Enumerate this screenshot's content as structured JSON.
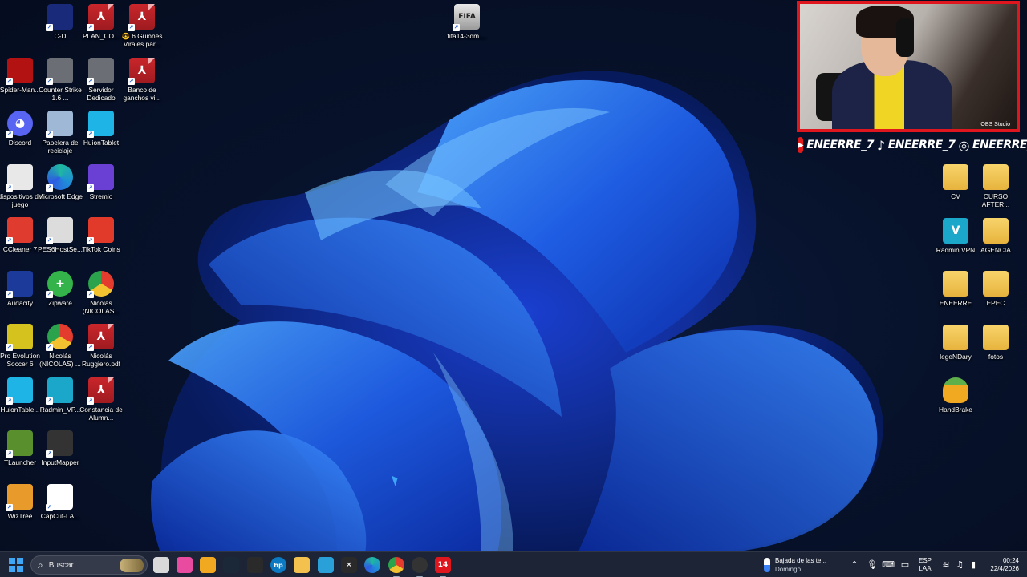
{
  "desktop": {
    "icons_left": [
      {
        "id": "cd",
        "label": "C-D",
        "icon": "ea-fc-icon",
        "color": "#1a2a7a"
      },
      {
        "id": "plan",
        "label": "PLAN_CO...",
        "icon": "pdf-icon",
        "color": "#c9262b"
      },
      {
        "id": "guiones",
        "label": "😎 6 Guiones Virales par...",
        "icon": "pdf-icon",
        "color": "#c9262b"
      },
      {
        "id": "spider",
        "label": "Spider-Man...",
        "icon": "spiderman-icon",
        "color": "#b31212"
      },
      {
        "id": "cs16",
        "label": "Counter Strike 1.6 ...",
        "icon": "counter-strike-icon",
        "color": "#6b6f75"
      },
      {
        "id": "servidor",
        "label": "Servidor Dedicado",
        "icon": "counter-strike-icon",
        "color": "#6b6f75"
      },
      {
        "id": "banco",
        "label": "Banco de ganchos vi...",
        "icon": "pdf-icon",
        "color": "#c9262b"
      },
      {
        "id": "discord",
        "label": "Discord",
        "icon": "discord-icon",
        "color": "#5865f2"
      },
      {
        "id": "papelera",
        "label": "Papelera de reciclaje",
        "icon": "recycle-bin-icon",
        "color": "#9fb8d6"
      },
      {
        "id": "huion",
        "label": "HuionTablet",
        "icon": "huion-icon",
        "color": "#1fb4e6"
      },
      {
        "id": "dispositivos",
        "label": "dispositivos de juego",
        "icon": "settings-file-icon",
        "color": "#e8e8e8"
      },
      {
        "id": "edge",
        "label": "Microsoft Edge",
        "icon": "edge-icon",
        "color": "#1f8fd6"
      },
      {
        "id": "stremio",
        "label": "Stremio",
        "icon": "stremio-icon",
        "color": "#6a3fd3"
      },
      {
        "id": "ccleaner",
        "label": "CCleaner 7",
        "icon": "ccleaner-icon",
        "color": "#e03b2f"
      },
      {
        "id": "pes6host",
        "label": "PES6HostSe...",
        "icon": "pes6host-icon",
        "color": "#dcdcdc"
      },
      {
        "id": "tiktokcoins",
        "label": "TikTok Coins",
        "icon": "tiktok-coins-icon",
        "color": "#e23a2a"
      },
      {
        "id": "audacity",
        "label": "Audacity",
        "icon": "audacity-icon",
        "color": "#1c3a9a"
      },
      {
        "id": "zipware",
        "label": "Zipware",
        "icon": "zipware-icon",
        "color": "#33b34a"
      },
      {
        "id": "chrome1",
        "label": "Nicolás (NICOLAS...",
        "icon": "chrome-icon",
        "color": "#e9b32c"
      },
      {
        "id": "pes6",
        "label": "Pro Evolution Soccer 6",
        "icon": "pes6-icon",
        "color": "#d6c21e"
      },
      {
        "id": "chrome2",
        "label": "Nicolás (NICOLAS) ...",
        "icon": "chrome-icon",
        "color": "#e9b32c"
      },
      {
        "id": "ruggiero",
        "label": "Nicolás Ruggiero.pdf",
        "icon": "pdf-icon",
        "color": "#c9262b"
      },
      {
        "id": "huion2",
        "label": "HuionTable...",
        "icon": "huion-icon",
        "color": "#1fb4e6"
      },
      {
        "id": "radmin2",
        "label": "Radmin_VP...",
        "icon": "radmin-icon",
        "color": "#1aa7c9"
      },
      {
        "id": "constancia",
        "label": "Constancia de Alumn...",
        "icon": "pdf-icon",
        "color": "#c9262b"
      },
      {
        "id": "tlauncher",
        "label": "TLauncher",
        "icon": "minecraft-icon",
        "color": "#5a8f2e"
      },
      {
        "id": "inputmapper",
        "label": "InputMapper",
        "icon": "inputmapper-icon",
        "color": "#333333"
      },
      {
        "id": "wiztree",
        "label": "WizTree",
        "icon": "wiztree-icon",
        "color": "#e89a2a"
      },
      {
        "id": "capcut",
        "label": "CapCut-LA...",
        "icon": "capcut-icon",
        "color": "#ffffff"
      }
    ],
    "icon_top": {
      "label": "fifa14-3dm....",
      "icon": "fifa-icon",
      "color": "#c9c9c9"
    },
    "icons_right": [
      {
        "id": "cv",
        "label": "CV",
        "icon": "folder-icon",
        "color": "#f2c14e"
      },
      {
        "id": "curso",
        "label": "CURSO AFTER...",
        "icon": "folder-icon",
        "color": "#f2c14e"
      },
      {
        "id": "radmin",
        "label": "Radmin VPN",
        "icon": "radmin-icon",
        "color": "#1aa7c9"
      },
      {
        "id": "agencia",
        "label": "AGENCIA",
        "icon": "folder-icon",
        "color": "#f2c14e"
      },
      {
        "id": "eneerre",
        "label": "ENEERRE",
        "icon": "folder-icon",
        "color": "#f2c14e"
      },
      {
        "id": "epec",
        "label": "EPEC",
        "icon": "folder-icon",
        "color": "#f2c14e"
      },
      {
        "id": "legendary",
        "label": "legeNDary",
        "icon": "folder-icon",
        "color": "#f2c14e"
      },
      {
        "id": "fotos",
        "label": "fotos",
        "icon": "folder-icon",
        "color": "#f2c14e"
      },
      {
        "id": "handbrake",
        "label": "HandBrake",
        "icon": "handbrake-icon",
        "color": "#e0582a"
      }
    ]
  },
  "overlay": {
    "handle1": "ENEERRE_7",
    "handle2": "ENEERRE_7",
    "handle3": "ENEERRE_7",
    "cam_caption": "OBS Studio"
  },
  "taskbar": {
    "search_placeholder": "Buscar",
    "apps": [
      {
        "name": "task-view-icon",
        "color": "#d9d9d9"
      },
      {
        "name": "photos-icon",
        "color": "#e94ba1"
      },
      {
        "name": "store-icon",
        "color": "#f2a922"
      },
      {
        "name": "steam-icon",
        "color": "#1b2838"
      },
      {
        "name": "epic-games-icon",
        "color": "#2a2a2a"
      },
      {
        "name": "hp-icon",
        "color": "#0b7ac2"
      },
      {
        "name": "file-explorer-icon",
        "color": "#f2c14e"
      },
      {
        "name": "vpn-icon",
        "color": "#2aa0d8"
      },
      {
        "name": "xbox-icon",
        "color": "#2a2a2a"
      },
      {
        "name": "edge-icon",
        "color": "#1f8fd6"
      },
      {
        "name": "chrome-icon",
        "color": "#e9b32c"
      },
      {
        "name": "obs-icon",
        "color": "#333333"
      },
      {
        "name": "calendar-app-icon",
        "color": "#e0161f"
      }
    ],
    "weather_title": "Bajada de las te...",
    "weather_sub": "Domingo",
    "lang_top": "ESP",
    "lang_bottom": "LAA",
    "time": "00:24",
    "date": "22/4/2026"
  }
}
